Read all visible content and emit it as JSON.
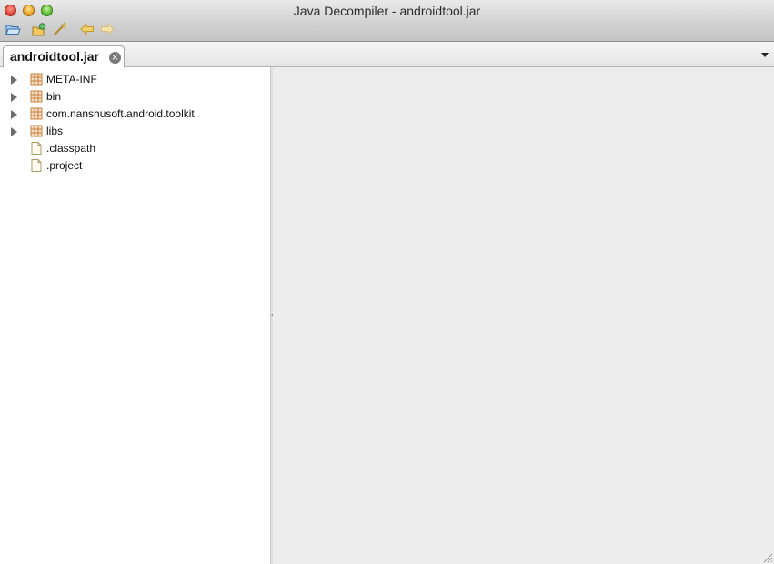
{
  "window": {
    "title": "Java Decompiler - androidtool.jar"
  },
  "toolbar": {
    "buttons": [
      {
        "name": "open-file",
        "icon": "folder-open-icon"
      },
      {
        "name": "open-type",
        "icon": "open-type-icon"
      },
      {
        "name": "search",
        "icon": "wand-icon"
      },
      {
        "name": "back",
        "icon": "arrow-left-icon"
      },
      {
        "name": "forward",
        "icon": "arrow-right-icon"
      }
    ]
  },
  "tabs": [
    {
      "label": "androidtool.jar",
      "close_glyph": "×"
    }
  ],
  "tree": {
    "items": [
      {
        "label": "META-INF",
        "type": "package",
        "expandable": true
      },
      {
        "label": "bin",
        "type": "package",
        "expandable": true
      },
      {
        "label": "com.nanshusoft.android.toolkit",
        "type": "package",
        "expandable": true
      },
      {
        "label": "libs",
        "type": "package",
        "expandable": true
      },
      {
        "label": ".classpath",
        "type": "file",
        "expandable": false
      },
      {
        "label": ".project",
        "type": "file",
        "expandable": false
      }
    ]
  },
  "colors": {
    "package_icon": "#c7813f",
    "nav_arrow": "#e2b54a"
  }
}
